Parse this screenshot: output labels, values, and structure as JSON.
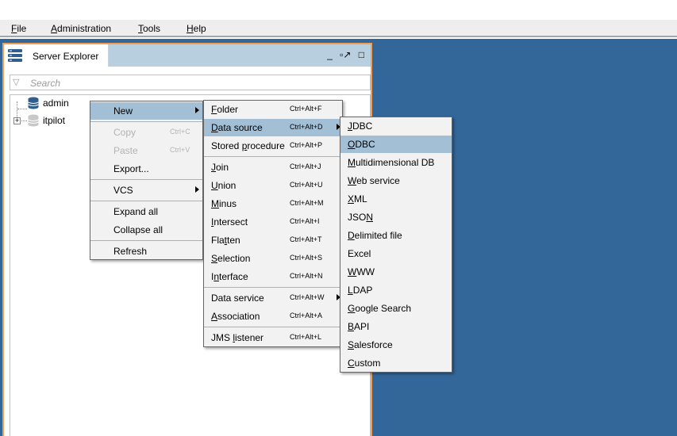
{
  "menubar": [
    {
      "pre": "",
      "u": "F",
      "post": "ile"
    },
    {
      "pre": "",
      "u": "A",
      "post": "dministration"
    },
    {
      "pre": "",
      "u": "T",
      "post": "ools"
    },
    {
      "pre": "",
      "u": "H",
      "post": "elp"
    }
  ],
  "panel": {
    "tab_label": "Server Explorer",
    "minimize": "_",
    "restore": "▫↗",
    "maximize": "□",
    "search_placeholder": "Search"
  },
  "tree": [
    {
      "label": "admin",
      "expander": ""
    },
    {
      "label": "itpilot",
      "expander": "+"
    }
  ],
  "context_menu": [
    {
      "label": "New",
      "shortcut": "",
      "submenu": true,
      "highlighted": true,
      "disabled": false
    },
    {
      "label": "Copy",
      "shortcut": "Ctrl+C",
      "submenu": false,
      "highlighted": false,
      "disabled": true
    },
    {
      "label": "Paste",
      "shortcut": "Ctrl+V",
      "submenu": false,
      "highlighted": false,
      "disabled": true
    },
    {
      "label": "Export...",
      "shortcut": "",
      "submenu": false,
      "highlighted": false,
      "disabled": false
    },
    {
      "label": "VCS",
      "shortcut": "",
      "submenu": true,
      "highlighted": false,
      "disabled": false
    },
    {
      "label": "Expand all",
      "shortcut": "",
      "submenu": false,
      "highlighted": false,
      "disabled": false
    },
    {
      "label": "Collapse all",
      "shortcut": "",
      "submenu": false,
      "highlighted": false,
      "disabled": false
    },
    {
      "label": "Refresh",
      "shortcut": "",
      "submenu": false,
      "highlighted": false,
      "disabled": false
    }
  ],
  "new_menu": [
    {
      "pre": "",
      "u": "F",
      "post": "older",
      "shortcut": "Ctrl+Alt+F"
    },
    {
      "pre": "",
      "u": "D",
      "post": "ata source",
      "shortcut": "Ctrl+Alt+D"
    },
    {
      "pre": "Stored ",
      "u": "p",
      "post": "rocedure",
      "shortcut": "Ctrl+Alt+P"
    },
    {
      "pre": "",
      "u": "J",
      "post": "oin",
      "shortcut": "Ctrl+Alt+J"
    },
    {
      "pre": "",
      "u": "U",
      "post": "nion",
      "shortcut": "Ctrl+Alt+U"
    },
    {
      "pre": "",
      "u": "M",
      "post": "inus",
      "shortcut": "Ctrl+Alt+M"
    },
    {
      "pre": "",
      "u": "I",
      "post": "ntersect",
      "shortcut": "Ctrl+Alt+I"
    },
    {
      "pre": "Fla",
      "u": "t",
      "post": "ten",
      "shortcut": "Ctrl+Alt+T"
    },
    {
      "pre": "",
      "u": "S",
      "post": "election",
      "shortcut": "Ctrl+Alt+S"
    },
    {
      "pre": "I",
      "u": "n",
      "post": "terface",
      "shortcut": "Ctrl+Alt+N"
    },
    {
      "pre": "Data service",
      "u": "",
      "post": "",
      "shortcut": "Ctrl+Alt+W"
    },
    {
      "pre": "",
      "u": "A",
      "post": "ssociation",
      "shortcut": "Ctrl+Alt+A"
    },
    {
      "pre": "JMS ",
      "u": "l",
      "post": "istener",
      "shortcut": "Ctrl+Alt+L"
    }
  ],
  "datasource_menu": [
    {
      "pre": "",
      "u": "J",
      "post": "DBC"
    },
    {
      "pre": "",
      "u": "O",
      "post": "DBC"
    },
    {
      "pre": "",
      "u": "M",
      "post": "ultidimensional DB"
    },
    {
      "pre": "",
      "u": "W",
      "post": "eb service"
    },
    {
      "pre": "",
      "u": "X",
      "post": "ML"
    },
    {
      "pre": "JSO",
      "u": "N",
      "post": ""
    },
    {
      "pre": "",
      "u": "D",
      "post": "elimited file"
    },
    {
      "pre": "Excel",
      "u": "",
      "post": ""
    },
    {
      "pre": "",
      "u": "W",
      "post": "WW"
    },
    {
      "pre": "",
      "u": "L",
      "post": "DAP"
    },
    {
      "pre": "",
      "u": "G",
      "post": "oogle Search"
    },
    {
      "pre": "",
      "u": "B",
      "post": "API"
    },
    {
      "pre": "",
      "u": "S",
      "post": "alesforce"
    },
    {
      "pre": "",
      "u": "C",
      "post": "ustom"
    }
  ],
  "colors": {
    "desktop": "#336699",
    "highlight": "#a3bfd6",
    "panel_border": "#f0a055"
  }
}
